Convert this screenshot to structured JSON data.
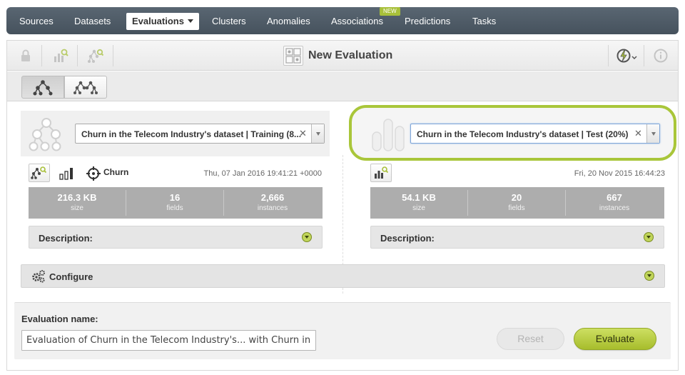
{
  "nav": {
    "items": [
      "Sources",
      "Datasets",
      "Evaluations",
      "Clusters",
      "Anomalies",
      "Associations",
      "Predictions",
      "Tasks"
    ],
    "active_index": 2,
    "new_badge": "NEW"
  },
  "toolbar": {
    "title": "New Evaluation",
    "icons": [
      "lock-icon",
      "model-chart-icon",
      "tree-model-icon",
      "lightning-icon",
      "info-icon"
    ]
  },
  "left": {
    "dataset_select": "Churn in the Telecom Industry's dataset | Training (8...",
    "target": "Churn",
    "date": "Thu, 07 Jan 2016 19:41:21 +0000",
    "stats": [
      {
        "value": "216.3 KB",
        "label": "size"
      },
      {
        "value": "16",
        "label": "fields"
      },
      {
        "value": "2,666",
        "label": "instances"
      }
    ],
    "description_label": "Description:"
  },
  "right": {
    "dataset_select": "Churn in the Telecom Industry's dataset | Test (20%)",
    "date": "Fri, 20 Nov 2015 16:44:23",
    "stats": [
      {
        "value": "54.1 KB",
        "label": "size"
      },
      {
        "value": "20",
        "label": "fields"
      },
      {
        "value": "667",
        "label": "instances"
      }
    ],
    "description_label": "Description:"
  },
  "configure": {
    "label": "Configure"
  },
  "form": {
    "name_label": "Evaluation name:",
    "name_value": "Evaluation of Churn in the Telecom Industry's... with Churn in the Telecom Industry's",
    "reset_label": "Reset",
    "evaluate_label": "Evaluate"
  },
  "colors": {
    "nav_bg": "#4e5a65",
    "accent_green": "#a9c63a",
    "stats_bg": "#adadad"
  }
}
